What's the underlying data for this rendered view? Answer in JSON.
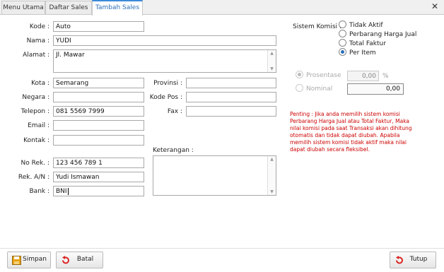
{
  "tabs": [
    {
      "label": "Menu Utama"
    },
    {
      "label": "Daftar Sales"
    },
    {
      "label": "Tambah Sales"
    }
  ],
  "close_glyph": "✕",
  "form": {
    "kode": {
      "label": "Kode :",
      "value": "Auto"
    },
    "nama": {
      "label": "Nama :",
      "value": "YUDI"
    },
    "alamat": {
      "label": "Alamat :",
      "value": "Jl. Mawar"
    },
    "kota": {
      "label": "Kota :",
      "value": "Semarang"
    },
    "provinsi": {
      "label": "Provinsi :",
      "value": ""
    },
    "negara": {
      "label": "Negara :",
      "value": ""
    },
    "kode_pos": {
      "label": "Kode Pos :",
      "value": ""
    },
    "telepon": {
      "label": "Telepon :",
      "value": "081 5569 7999"
    },
    "fax": {
      "label": "Fax :",
      "value": ""
    },
    "email": {
      "label": "Email :",
      "value": ""
    },
    "kontak": {
      "label": "Kontak :",
      "value": ""
    },
    "keterangan": {
      "label": "Keterangan :",
      "value": ""
    },
    "no_rek": {
      "label": "No Rek. :",
      "value": "123 456 789 1"
    },
    "rek_an": {
      "label": "Rek. A/N :",
      "value": "Yudi Ismawan"
    },
    "bank": {
      "label": "Bank :",
      "value": "BNI"
    }
  },
  "komisi": {
    "label": "Sistem Komisi :",
    "options": [
      {
        "label": "Tidak Aktif",
        "checked": false
      },
      {
        "label": "Perbarang Harga Jual",
        "checked": false
      },
      {
        "label": "Total Faktur",
        "checked": false
      },
      {
        "label": "Per Item",
        "checked": true
      }
    ],
    "prosentase": {
      "label": "Prosentase",
      "value": "0,00",
      "unit": "%"
    },
    "nominal": {
      "label": "Nominal",
      "value": "0,00"
    },
    "note": "Penting : Jika anda memilih sistem komisi Perbarang Harga Jual atau Total Faktur, Maka nilai komisi pada saat Transaksi akan dihitung otomatis dan tidak dapat diubah. Apabila memilih sistem komisi tidak aktif maka nilai dapat diubah secara fleksibel."
  },
  "buttons": {
    "simpan": "Simpan",
    "batal": "Batal",
    "tutup": "Tutup"
  },
  "colors": {
    "accent": "#2a6fb8",
    "note": "#cc0000"
  }
}
